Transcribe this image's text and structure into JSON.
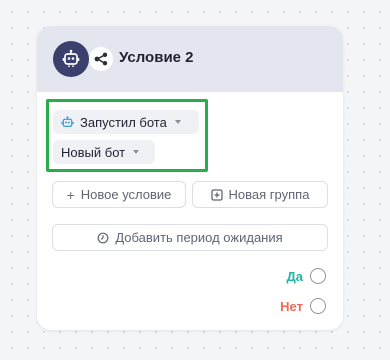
{
  "node": {
    "title": "Условие 2",
    "avatar_icon": "robot-icon",
    "type_icon": "share-branch-icon",
    "header_color": "#e3e6ef",
    "avatar_color": "#3b3f6e"
  },
  "condition": {
    "event_label": "Запустил бота",
    "event_icon": "robot-icon",
    "bot_label": "Новый бот",
    "highlight_color": "#27ae4b"
  },
  "actions": {
    "add_condition_icon": "+",
    "add_condition_label": "Новое условие",
    "new_group_label": "Новая группа",
    "add_wait_label": "Добавить период ожидания"
  },
  "outputs": {
    "yes_label": "Да",
    "yes_color": "#1fb5a8",
    "no_label": "Нет",
    "no_color": "#ef6a5a"
  }
}
